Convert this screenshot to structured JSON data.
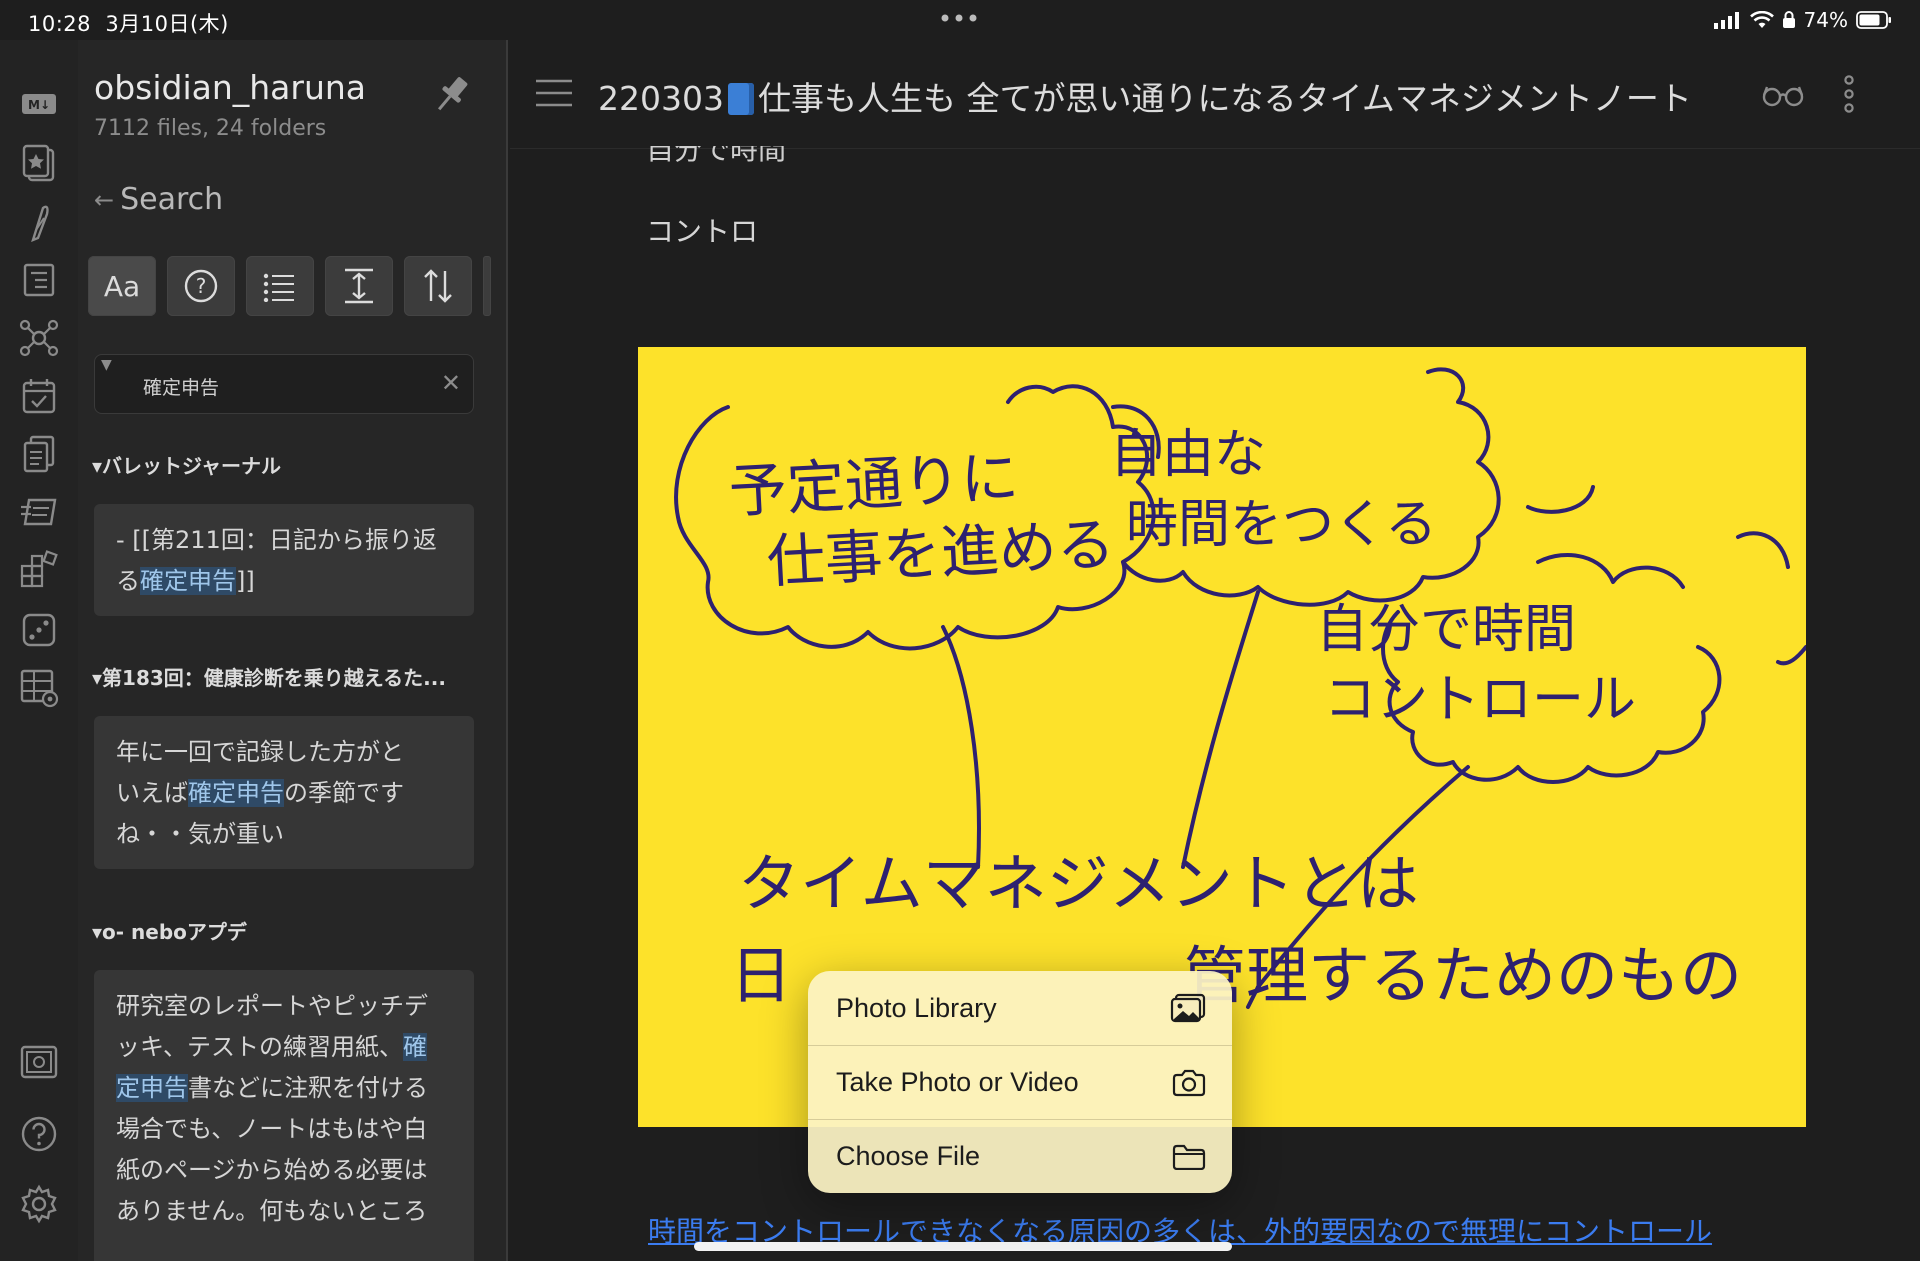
{
  "status_bar": {
    "time": "10:28",
    "date": "3月10日(木)",
    "battery": "74%"
  },
  "ribbon": {
    "icons": [
      "markdown-icon",
      "cards-icon",
      "feather-icon",
      "outline-icon",
      "graph-view-icon",
      "calendar-icon",
      "templates-icon",
      "slides-icon",
      "plugins-icon",
      "dice-icon",
      "table-settings-icon",
      "screenshot-icon",
      "help-icon",
      "settings-icon"
    ]
  },
  "left_panel": {
    "vault_name": "obsidian_haruna",
    "vault_stats": "7112 files, 24 folders",
    "back_label": "Search",
    "toolbar": {
      "match_case_label": "Aa",
      "explain_label": "?"
    },
    "search": {
      "query": "確定申告"
    },
    "results": [
      {
        "group": "▾バレットジャーナル",
        "lines": [
          {
            "pre": "- [[第211回：日記から振り返",
            "hl": "",
            "post": ""
          },
          {
            "pre": "る",
            "hl": "確定申告",
            "post": "]]"
          }
        ]
      },
      {
        "group": "▾第183回：健康診断を乗り越えるた...",
        "lines": [
          {
            "pre": " 年に一回で記録した方がと",
            "hl": "",
            "post": ""
          },
          {
            "pre": "いえば",
            "hl": "確定申告",
            "post": "の季節です"
          },
          {
            "pre": "ね・・気が重い",
            "hl": "",
            "post": ""
          }
        ]
      },
      {
        "group": "▾o- neboアプデ",
        "lines": [
          {
            "pre": "研究室のレポートやピッチデ",
            "hl": "",
            "post": ""
          },
          {
            "pre": "ッキ、テストの練習用紙、",
            "hl": "確",
            "post": ""
          },
          {
            "pre": "",
            "hl": "定申告",
            "post": "書などに注釈を付ける"
          },
          {
            "pre": "場合でも、ノートはもはや白",
            "hl": "",
            "post": ""
          },
          {
            "pre": "紙のページから始める必要は",
            "hl": "",
            "post": ""
          },
          {
            "pre": "ありません。何もないところ",
            "hl": "",
            "post": ""
          }
        ]
      }
    ]
  },
  "main": {
    "title_prefix": "220303",
    "title_text": "仕事も人生も 全てが思い通りになるタイムマネジメントノート",
    "text_cut": "自分で時間",
    "text_line": "コントロ",
    "bottom_link": "時間をコントロールできなくなる原因の多くは、外的要因なので無理にコントロール"
  },
  "sketch": {
    "cloud1_line1": "予定通りに",
    "cloud1_line2": "仕事を進める",
    "cloud2_line1": "自由な",
    "cloud2_line2": "時間をつくる",
    "cloud3_line1": "自分で時間",
    "cloud3_line2": "コントロール",
    "bottom_line1": "タイムマネジメントとは",
    "bottom_line2": "日",
    "bottom_line2b": "管理するためのもの",
    "background": "#fde22a",
    "ink": "#2e2170"
  },
  "popup": {
    "items": [
      {
        "label": "Photo Library",
        "icon": "photo-library-icon"
      },
      {
        "label": "Take Photo or Video",
        "icon": "camera-icon"
      },
      {
        "label": "Choose File",
        "icon": "folder-icon"
      }
    ]
  }
}
